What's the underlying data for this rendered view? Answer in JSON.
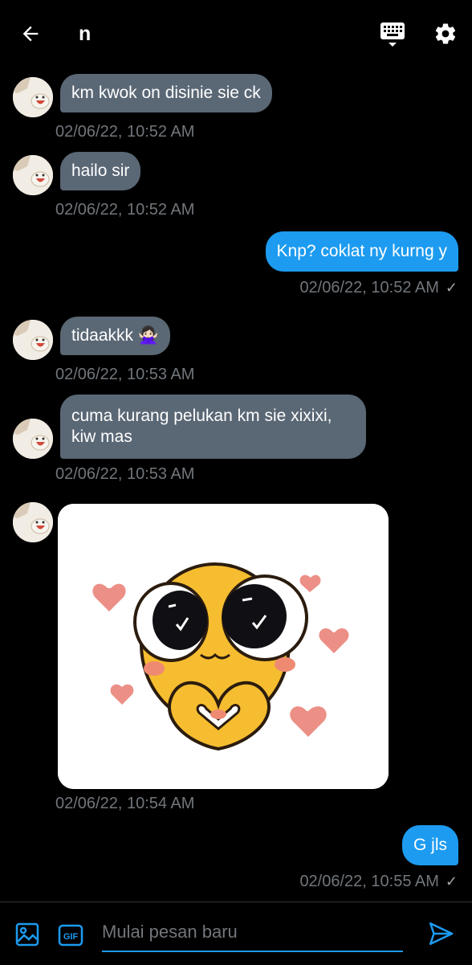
{
  "header": {
    "title": "n",
    "back_icon": "arrow-left-icon",
    "keyboard_icon": "keyboard-icon",
    "settings_icon": "gear-icon"
  },
  "colors": {
    "background": "#000000",
    "incoming_bubble": "#5a6775",
    "outgoing_bubble": "#1d9bf0",
    "timestamp": "#71767b",
    "accent": "#1d9bf0"
  },
  "messages": [
    {
      "direction": "in",
      "text": "km kwok on disinie sie ck",
      "time": "02/06/22, 10:52 AM"
    },
    {
      "direction": "in",
      "text": "hailo sir",
      "time": "02/06/22, 10:52 AM"
    },
    {
      "direction": "out",
      "text": "Knp? coklat ny kurng y",
      "time": "02/06/22, 10:52 AM",
      "status": "✓"
    },
    {
      "direction": "in",
      "text": "tidaakkk 🙅🏻‍♀️",
      "time": "02/06/22, 10:53 AM"
    },
    {
      "direction": "in",
      "text": "cuma kurang pelukan km sie xixixi, kiw mas",
      "time": "02/06/22, 10:53 AM"
    },
    {
      "direction": "in",
      "type": "sticker",
      "sticker_name": "cute-face-heart-hands-sticker",
      "time": "02/06/22, 10:54 AM"
    },
    {
      "direction": "out",
      "text": "G jls",
      "time": "02/06/22, 10:55 AM",
      "status": "✓"
    }
  ],
  "composer": {
    "placeholder": "Mulai pesan baru",
    "value": "",
    "image_icon": "image-icon",
    "gif_icon": "gif-icon",
    "gif_label": "GIF",
    "send_icon": "send-icon"
  }
}
